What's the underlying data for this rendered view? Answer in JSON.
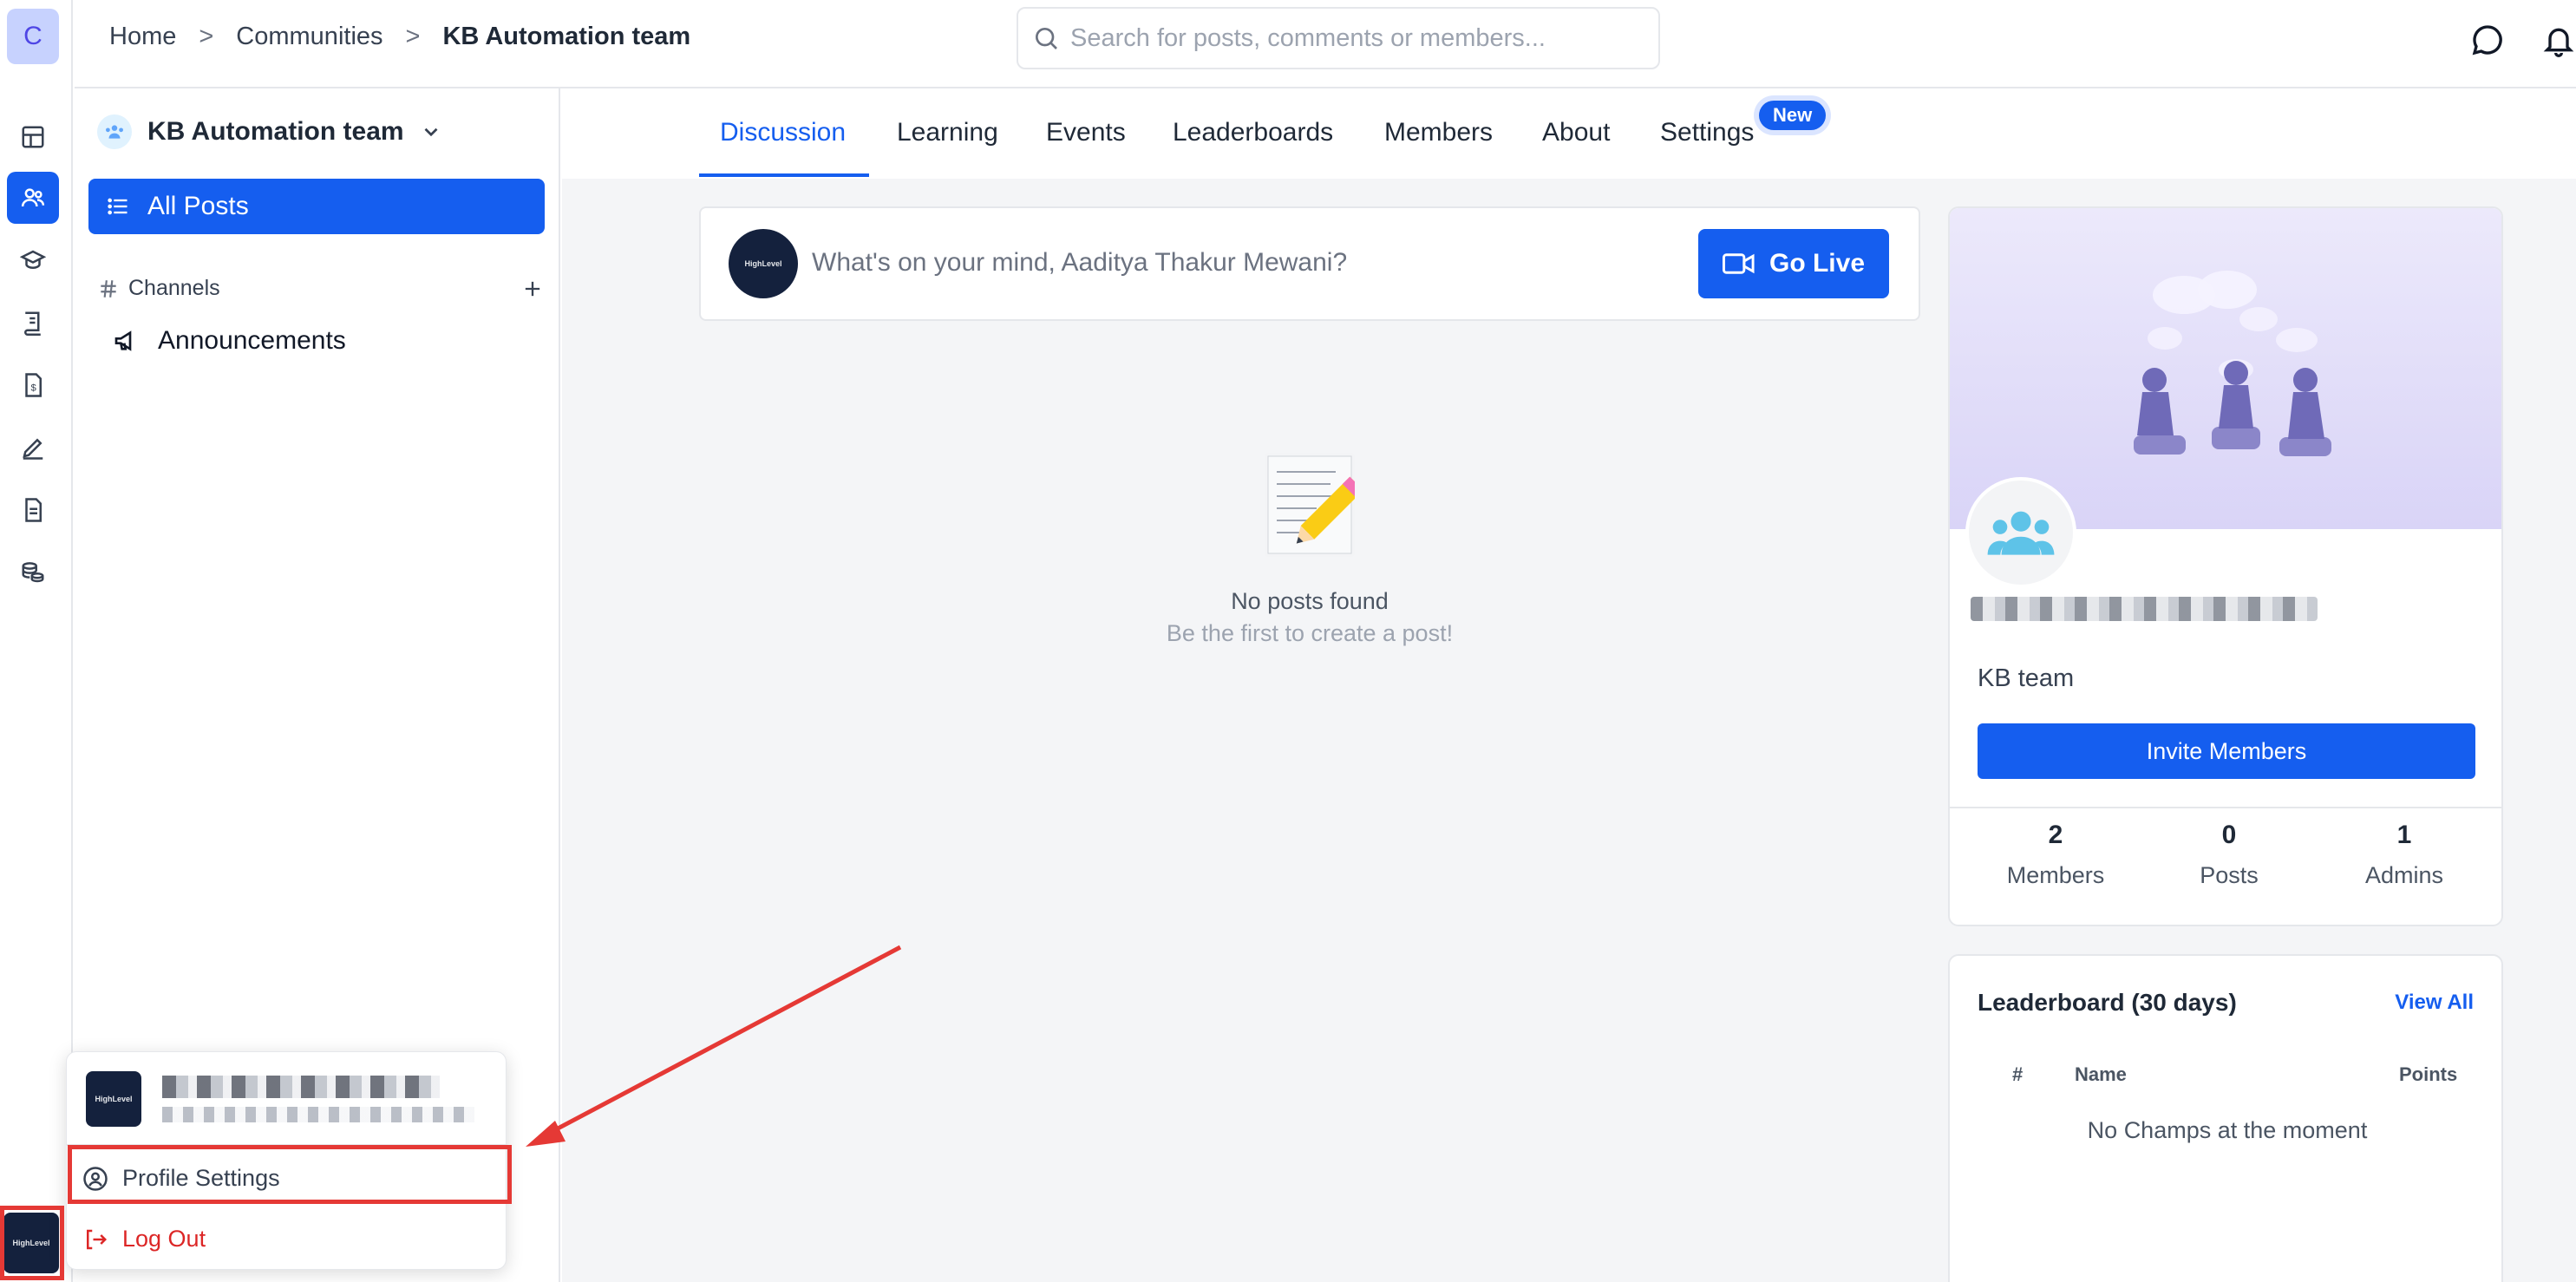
{
  "rail": {
    "avatar_letter": "C"
  },
  "breadcrumb": {
    "home": "Home",
    "sep": ">",
    "communities": "Communities",
    "current": "KB Automation team"
  },
  "search": {
    "placeholder": "Search for posts, comments or members..."
  },
  "sidebar": {
    "community_name": "KB Automation team",
    "all_posts": "All Posts",
    "channels_label": "Channels",
    "channels": [
      {
        "label": "Announcements"
      }
    ]
  },
  "tabs": [
    {
      "label": "Discussion",
      "active": true
    },
    {
      "label": "Learning"
    },
    {
      "label": "Events"
    },
    {
      "label": "Leaderboards"
    },
    {
      "label": "Members"
    },
    {
      "label": "About"
    },
    {
      "label": "Settings"
    }
  ],
  "new_badge": "New",
  "composer": {
    "placeholder": "What's on your mind, Aaditya Thakur Mewani?",
    "go_live": "Go Live"
  },
  "empty_state": {
    "title": "No posts found",
    "subtitle": "Be the first to create a post!"
  },
  "about": {
    "description": "KB team",
    "invite_button": "Invite Members",
    "stats": [
      {
        "value": "2",
        "label": "Members"
      },
      {
        "value": "0",
        "label": "Posts"
      },
      {
        "value": "1",
        "label": "Admins"
      }
    ]
  },
  "leaderboard": {
    "title": "Leaderboard (30 days)",
    "view_all": "View All",
    "columns": [
      "#",
      "Name",
      "Points"
    ],
    "empty": "No Champs at the moment"
  },
  "logo": {
    "brand": "HighLevel"
  },
  "popup": {
    "profile_settings": "Profile Settings",
    "log_out": "Log Out"
  },
  "colors": {
    "primary": "#155eef",
    "annotation": "#e53935",
    "danger": "#dc2626"
  }
}
